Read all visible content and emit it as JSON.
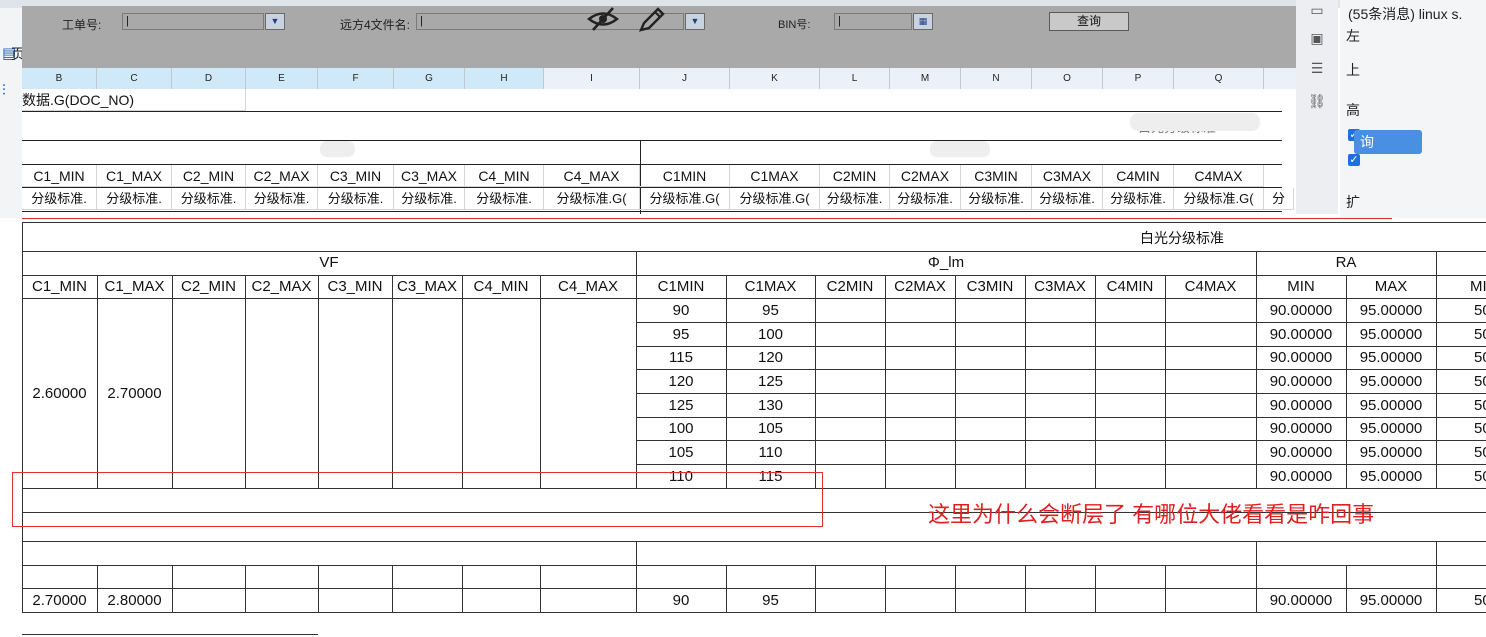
{
  "browser": {
    "tab_text": "(55条消息) linux s.",
    "left_rail_label": "页"
  },
  "right_panel": {
    "label_left": "左",
    "label_top": "上",
    "label_high": "高",
    "query_label": "询",
    "label_expand": "扩"
  },
  "param_bar": {
    "work_no_label": "工单号:",
    "file_name_label": "远方4文件名:",
    "bin_label": "BIN号:",
    "query_button": "查询",
    "eye_icon": "eye-slash-icon",
    "pen_icon": "pencil-icon"
  },
  "designer": {
    "column_letters": [
      "B",
      "C",
      "D",
      "E",
      "F",
      "G",
      "H",
      "I",
      "J",
      "K",
      "L",
      "M",
      "N",
      "O",
      "P",
      "Q"
    ],
    "dataset_expr": "数据.G(DOC_NO)",
    "header_labels": [
      "C1_MIN",
      "C1_MAX",
      "C2_MIN",
      "C2_MAX",
      "C3_MIN",
      "C3_MAX",
      "C4_MIN",
      "C4_MAX",
      "C1MIN",
      "C1MAX",
      "C2MIN",
      "C2MAX",
      "C3MIN",
      "C3MAX",
      "C4MIN",
      "C4MAX"
    ],
    "formula_cells": [
      "分级标准.",
      "分级标准.",
      "分级标准.",
      "分级标准.",
      "分级标准.",
      "分级标准.",
      "分级标准.",
      "分级标准.G(",
      "分级标准.G(",
      "分级标准.G(",
      "分级标准.",
      "分级标准.",
      "分级标准.",
      "分级标准.",
      "分级标准.",
      "分级标准.G(",
      "分"
    ],
    "title_partial": "白光分级标准"
  },
  "preview": {
    "title": "白光分级标准",
    "group_vf": "VF",
    "group_phi": "Φ_lm",
    "group_ra": "RA",
    "vf_columns": [
      "C1_MIN",
      "C1_MAX",
      "C2_MIN",
      "C2_MAX",
      "C3_MIN",
      "C3_MAX",
      "C4_MIN",
      "C4_MAX"
    ],
    "phi_columns": [
      "C1MIN",
      "C1MAX",
      "C2MIN",
      "C2MAX",
      "C3MIN",
      "C3MAX",
      "C4MIN",
      "C4MAX"
    ],
    "ra_columns": [
      "MIN",
      "MAX",
      "MI"
    ],
    "block1": {
      "c1_min": "2.60000",
      "c1_max": "2.70000",
      "phi_rows": [
        {
          "c1min": "90",
          "c1max": "95",
          "ra_min": "90.00000",
          "ra_max": "95.00000",
          "ra_extra": "50"
        },
        {
          "c1min": "95",
          "c1max": "100",
          "ra_min": "90.00000",
          "ra_max": "95.00000",
          "ra_extra": "50"
        },
        {
          "c1min": "115",
          "c1max": "120",
          "ra_min": "90.00000",
          "ra_max": "95.00000",
          "ra_extra": "50"
        },
        {
          "c1min": "120",
          "c1max": "125",
          "ra_min": "90.00000",
          "ra_max": "95.00000",
          "ra_extra": "50"
        },
        {
          "c1min": "125",
          "c1max": "130",
          "ra_min": "90.00000",
          "ra_max": "95.00000",
          "ra_extra": "50"
        },
        {
          "c1min": "100",
          "c1max": "105",
          "ra_min": "90.00000",
          "ra_max": "95.00000",
          "ra_extra": "50"
        },
        {
          "c1min": "105",
          "c1max": "110",
          "ra_min": "90.00000",
          "ra_max": "95.00000",
          "ra_extra": "50"
        },
        {
          "c1min": "110",
          "c1max": "115",
          "ra_min": "90.00000",
          "ra_max": "95.00000",
          "ra_extra": "50"
        }
      ]
    },
    "block2": {
      "c1_min": "2.70000",
      "c1_max": "2.80000",
      "c1min": "90",
      "c1max": "95",
      "ra_min": "90.00000",
      "ra_max": "95.00000",
      "ra_extra": "50"
    }
  },
  "annotation": {
    "text": "这里为什么会断层了 有哪位大佬看看是咋回事",
    "color": "#e02020"
  }
}
